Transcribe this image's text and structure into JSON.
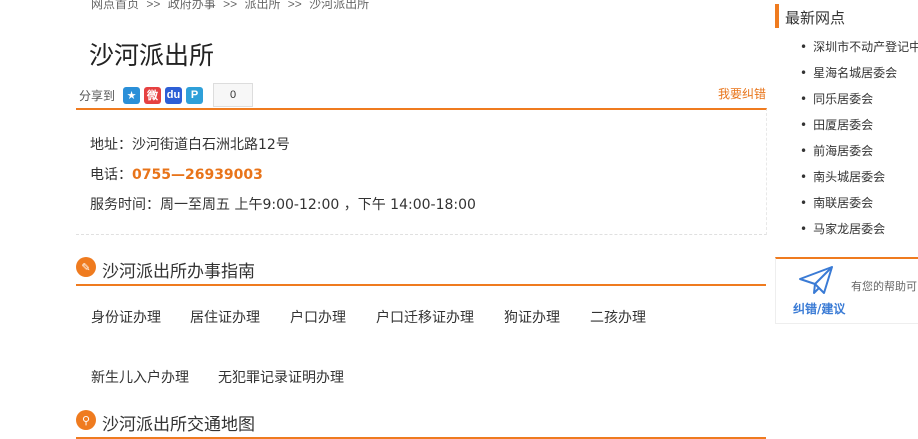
{
  "breadcrumb": [
    "网点首页",
    ">>",
    "政府办事",
    ">>",
    "派出所",
    ">>",
    "沙河派出所"
  ],
  "page_title": "沙河派出所",
  "share": {
    "label": "分享到",
    "count": "0",
    "icons": [
      "qzone-icon",
      "weibo-icon",
      "baidu-icon",
      "pengyou-icon"
    ]
  },
  "report_label": "我要纠错",
  "info": {
    "address": "地址：沙河街道白石洲北路12号",
    "phone_label": "电话：",
    "phone_value": "0755—26939003",
    "hours": "服务时间：周一至周五 上午9:00-12:00 ，下午 14:00-18:00"
  },
  "guide": {
    "title": "沙河派出所办事指南",
    "links": [
      "身份证办理",
      "居住证办理",
      "户口办理",
      "户口迁移证办理",
      "狗证办理",
      "二孩办理",
      "新生儿入户办理",
      "无犯罪记录证明办理"
    ]
  },
  "traffic": {
    "title": "沙河派出所交通地图"
  },
  "sidebar": {
    "title": "最新网点",
    "items": [
      "深圳市不动产登记中",
      "星海名城居委会",
      "同乐居委会",
      "田厦居委会",
      "前海居委会",
      "南头城居委会",
      "南联居委会",
      "马家龙居委会"
    ]
  },
  "feedback": {
    "label": "纠错/建议",
    "text": "有您的帮助可"
  },
  "colors": {
    "accent": "#ef7b1f",
    "link_blue": "#3a7bd5"
  }
}
